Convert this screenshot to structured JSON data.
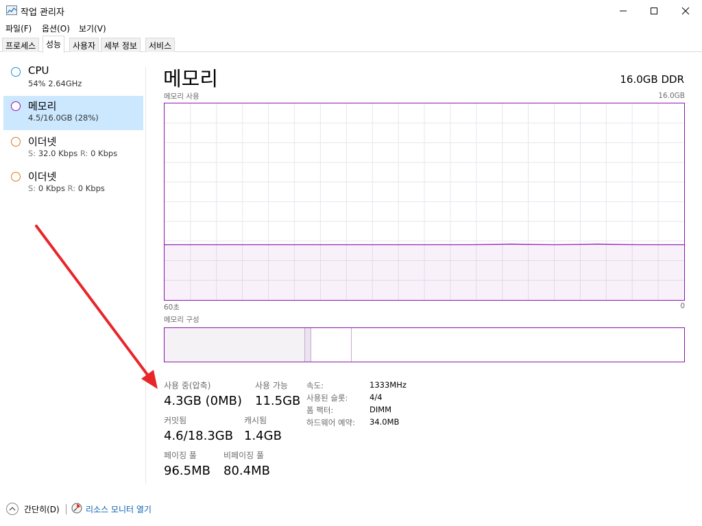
{
  "window": {
    "title": "작업 관리자"
  },
  "menu": {
    "file": "파일(F)",
    "options": "옵션(O)",
    "view": "보기(V)"
  },
  "tabs": [
    "프로세스",
    "성능",
    "사용자",
    "세부 정보",
    "서비스"
  ],
  "sidebar": {
    "cpu": {
      "title": "CPU",
      "sub": "54%  2.64GHz",
      "color": "#1a8fd6"
    },
    "memory": {
      "title": "메모리",
      "sub": "4.5/16.0GB (28%)",
      "color": "#8b12ae"
    },
    "eth1": {
      "title": "이더넷",
      "s_label": "S:",
      "s_value": "32.0 Kbps",
      "r_label": "R:",
      "r_value": "0 Kbps",
      "color": "#d87a1e"
    },
    "eth2": {
      "title": "이더넷",
      "s_label": "S:",
      "s_value": "0 Kbps",
      "r_label": "R:",
      "r_value": "0 Kbps",
      "color": "#d87a1e"
    }
  },
  "main": {
    "title": "메모리",
    "spec": "16.0GB DDR",
    "usage_label": "메모리 사용",
    "usage_max": "16.0GB",
    "time_left": "60초",
    "time_right": "0",
    "composition_label": "메모리 구성"
  },
  "chart_data": {
    "type": "area",
    "title": "메모리 사용",
    "xlabel_left": "60초",
    "xlabel_right": "0",
    "ylim": [
      0,
      16.0
    ],
    "unit": "GB",
    "x": [
      60,
      55,
      50,
      45,
      40,
      35,
      30,
      25,
      20,
      15,
      10,
      5,
      0
    ],
    "series": [
      {
        "values": [
          4.5,
          4.5,
          4.5,
          4.5,
          4.5,
          4.5,
          4.5,
          4.5,
          4.55,
          4.5,
          4.55,
          4.5,
          4.5
        ]
      }
    ],
    "color": "#8b12ae",
    "grid": true
  },
  "composition": {
    "in_use_fraction": 0.27,
    "modified_fraction": 0.012,
    "standby_fraction": 0.078
  },
  "stats": {
    "in_use_label": "사용 중(압축)",
    "in_use_value": "4.3GB (0MB)",
    "available_label": "사용 가능",
    "available_value": "11.5GB",
    "committed_label": "커밋됨",
    "committed_value": "4.6/18.3GB",
    "cached_label": "캐시됨",
    "cached_value": "1.4GB",
    "paged_label": "페이징 풀",
    "paged_value": "96.5MB",
    "nonpaged_label": "비페이징 풀",
    "nonpaged_value": "80.4MB"
  },
  "details": [
    {
      "key": "속도:",
      "value": "1333MHz"
    },
    {
      "key": "사용된 슬롯:",
      "value": "4/4"
    },
    {
      "key": "폼 팩터:",
      "value": "DIMM"
    },
    {
      "key": "하드웨어 예약:",
      "value": "34.0MB"
    }
  ],
  "footer": {
    "collapse": "간단히(D)",
    "resmon": "리소스 모니터 열기"
  },
  "annotation": {
    "arrow_color": "#e8262a"
  }
}
